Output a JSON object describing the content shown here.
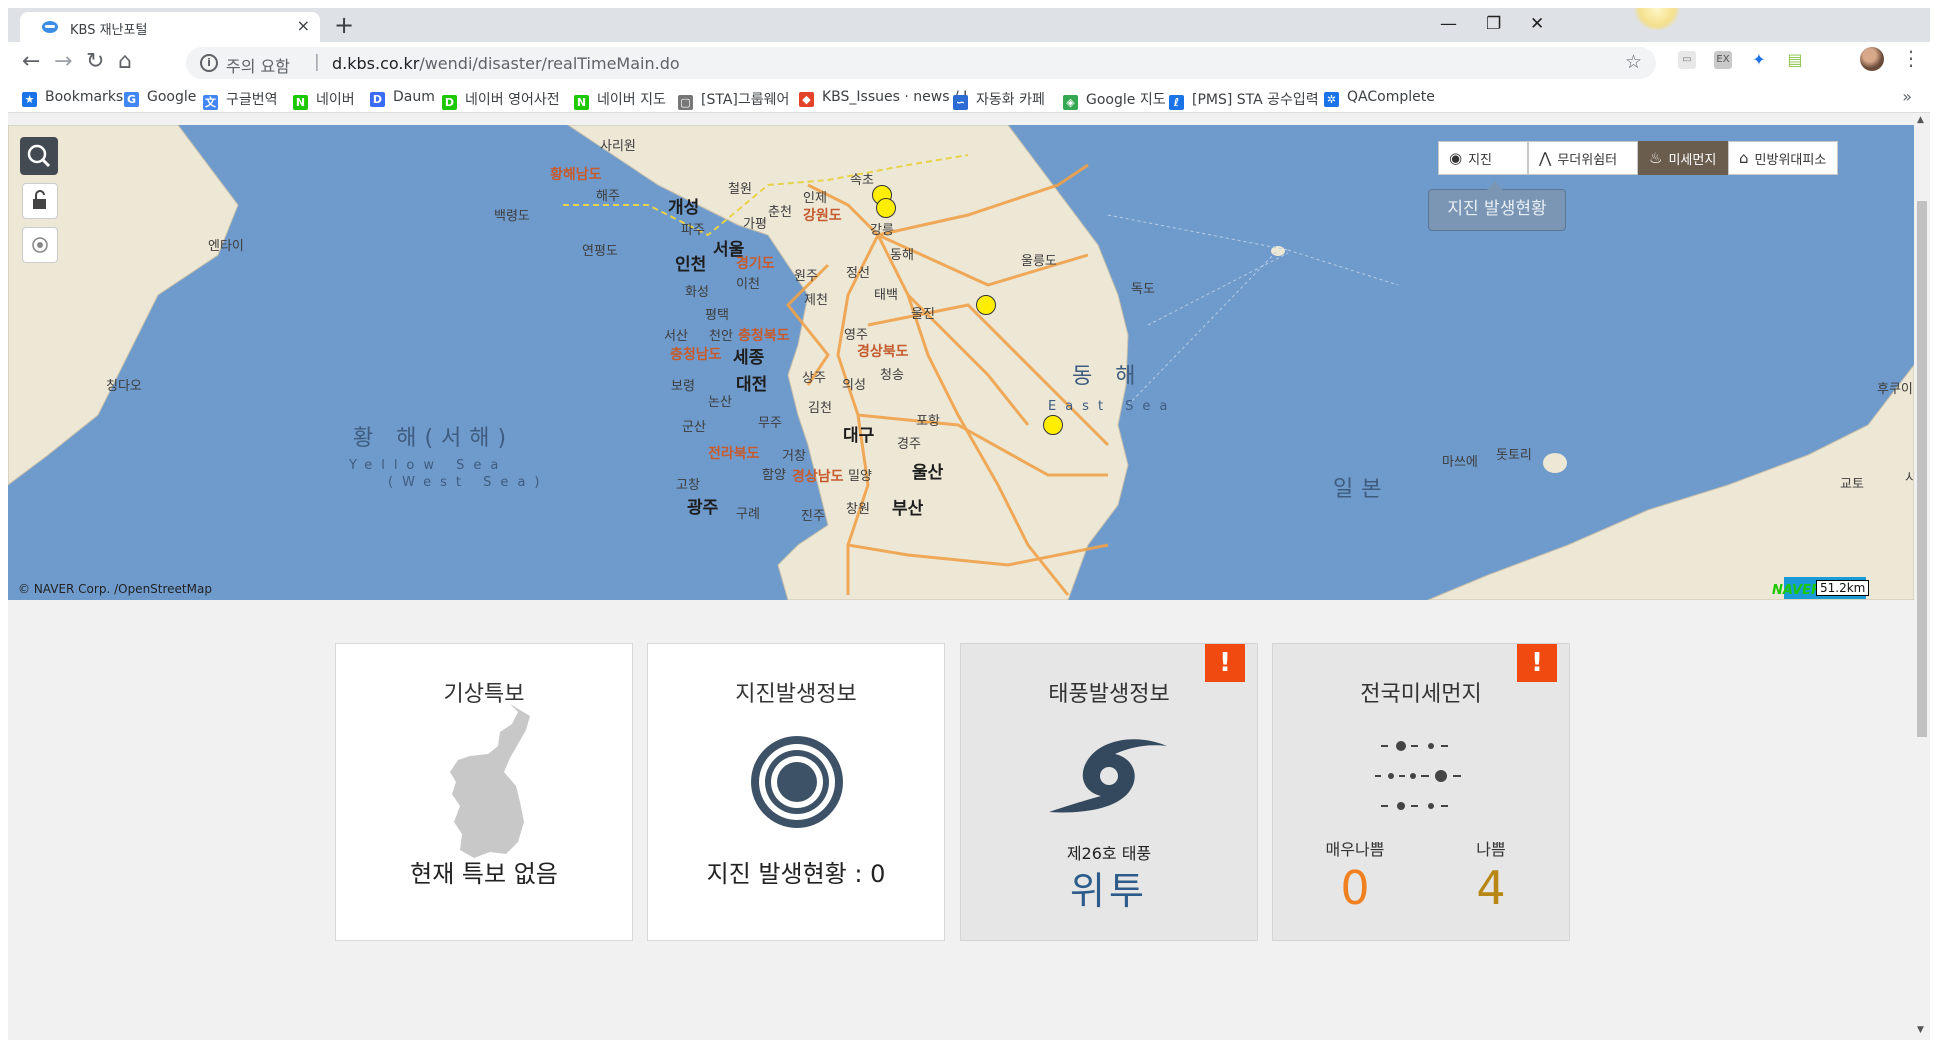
{
  "browser": {
    "tab_title": "KBS 재난포털",
    "tab_close": "×",
    "new_tab": "+",
    "window_controls": {
      "minimize": "—",
      "maximize": "❐",
      "close": "✕"
    },
    "nav": {
      "back": "←",
      "forward": "→",
      "reload": "↻",
      "home": "⌂"
    },
    "omnibox": {
      "security_text": "주의 요함",
      "separator": "|",
      "url_host": "d.kbs.co.kr",
      "url_path": "/wendi/disaster/realTimeMain.do",
      "star": "☆"
    },
    "menu": "⋮"
  },
  "bookmarks": {
    "items": [
      {
        "label": "Bookmarks",
        "icon": "star-icon",
        "color": "#1a73e8"
      },
      {
        "label": "Google",
        "icon": "google-icon",
        "color": "#4285f4"
      },
      {
        "label": "구글번역",
        "icon": "translate-icon",
        "color": "#4285f4"
      },
      {
        "label": "네이버",
        "icon": "naver-icon",
        "color": "#1ec800"
      },
      {
        "label": "Daum",
        "icon": "daum-icon",
        "color": "#3a6cf4"
      },
      {
        "label": "네이버 영어사전",
        "icon": "dictionary-icon",
        "color": "#1ec800"
      },
      {
        "label": "네이버 지도",
        "icon": "naver-icon",
        "color": "#1ec800"
      },
      {
        "label": "[STA]그룹웨어",
        "icon": "page-icon",
        "color": "#777777"
      },
      {
        "label": "KBS_Issues · news / I",
        "icon": "gitlab-icon",
        "color": "#e24329"
      },
      {
        "label": "자동화 카페",
        "icon": "cafe-icon",
        "color": "#2d6bd4"
      },
      {
        "label": "Google 지도",
        "icon": "maps-icon",
        "color": "#34a853"
      },
      {
        "label": "[PMS] STA 공수입력",
        "icon": "pms-icon",
        "color": "#1a73e8"
      },
      {
        "label": "QAComplete",
        "icon": "qa-icon",
        "color": "#1a73e8"
      }
    ],
    "more": "»"
  },
  "map": {
    "labels": [
      {
        "text": "황해남도",
        "cls": "prov"
      },
      {
        "text": "사리원",
        "cls": ""
      },
      {
        "text": "해주",
        "cls": ""
      },
      {
        "text": "개성",
        "cls": "city"
      },
      {
        "text": "백령도",
        "cls": ""
      },
      {
        "text": "연평도",
        "cls": ""
      },
      {
        "text": "서울",
        "cls": "city"
      },
      {
        "text": "인천",
        "cls": "city"
      },
      {
        "text": "파주",
        "cls": ""
      },
      {
        "text": "철원",
        "cls": ""
      },
      {
        "text": "춘천",
        "cls": ""
      },
      {
        "text": "가평",
        "cls": ""
      },
      {
        "text": "인제",
        "cls": ""
      },
      {
        "text": "속초",
        "cls": ""
      },
      {
        "text": "강원도",
        "cls": "prov"
      },
      {
        "text": "강릉",
        "cls": ""
      },
      {
        "text": "동해",
        "cls": ""
      },
      {
        "text": "경기도",
        "cls": "prov"
      },
      {
        "text": "이천",
        "cls": ""
      },
      {
        "text": "원주",
        "cls": ""
      },
      {
        "text": "정선",
        "cls": ""
      },
      {
        "text": "태백",
        "cls": ""
      },
      {
        "text": "제천",
        "cls": ""
      },
      {
        "text": "화성",
        "cls": ""
      },
      {
        "text": "평택",
        "cls": ""
      },
      {
        "text": "울진",
        "cls": ""
      },
      {
        "text": "서산",
        "cls": ""
      },
      {
        "text": "천안",
        "cls": ""
      },
      {
        "text": "충청북도",
        "cls": "prov"
      },
      {
        "text": "충청남도",
        "cls": "prov"
      },
      {
        "text": "세종",
        "cls": "city"
      },
      {
        "text": "영주",
        "cls": ""
      },
      {
        "text": "경상북도",
        "cls": "prov"
      },
      {
        "text": "청송",
        "cls": ""
      },
      {
        "text": "보령",
        "cls": ""
      },
      {
        "text": "대전",
        "cls": "city"
      },
      {
        "text": "상주",
        "cls": ""
      },
      {
        "text": "의성",
        "cls": ""
      },
      {
        "text": "논산",
        "cls": ""
      },
      {
        "text": "김천",
        "cls": ""
      },
      {
        "text": "포항",
        "cls": ""
      },
      {
        "text": "군산",
        "cls": ""
      },
      {
        "text": "무주",
        "cls": ""
      },
      {
        "text": "대구",
        "cls": "city"
      },
      {
        "text": "경주",
        "cls": ""
      },
      {
        "text": "전라북도",
        "cls": "prov"
      },
      {
        "text": "거창",
        "cls": ""
      },
      {
        "text": "울산",
        "cls": "city"
      },
      {
        "text": "함양",
        "cls": ""
      },
      {
        "text": "경상남도",
        "cls": "prov"
      },
      {
        "text": "밀양",
        "cls": ""
      },
      {
        "text": "고창",
        "cls": ""
      },
      {
        "text": "광주",
        "cls": "city"
      },
      {
        "text": "구례",
        "cls": ""
      },
      {
        "text": "진주",
        "cls": ""
      },
      {
        "text": "창원",
        "cls": ""
      },
      {
        "text": "부산",
        "cls": "city"
      },
      {
        "text": "울릉도",
        "cls": ""
      },
      {
        "text": "독도",
        "cls": ""
      },
      {
        "text": "엔타이",
        "cls": ""
      },
      {
        "text": "칭다오",
        "cls": ""
      },
      {
        "text": "황 해(서해)",
        "cls": "sea"
      },
      {
        "text": "Yellow Sea",
        "cls": "sea-en"
      },
      {
        "text": "(West Sea)",
        "cls": "sea-en"
      },
      {
        "text": "동 해",
        "cls": "sea"
      },
      {
        "text": "East Sea",
        "cls": "sea-en"
      },
      {
        "text": "일본",
        "cls": "sea"
      },
      {
        "text": "마쓰에",
        "cls": ""
      },
      {
        "text": "돗토리",
        "cls": ""
      },
      {
        "text": "후쿠이",
        "cls": ""
      },
      {
        "text": "교토",
        "cls": ""
      },
      {
        "text": "시마네",
        "cls": ""
      }
    ],
    "copyright": "© NAVER Corp. /OpenStreetMap",
    "logo": "NAVER",
    "scale": "51.2km",
    "layer_buttons": [
      {
        "label": "지진",
        "icon": "earthquake-icon",
        "glyph": "◉",
        "active": false
      },
      {
        "label": "무더위쉼터",
        "icon": "shelter-icon",
        "glyph": "⋀",
        "active": false
      },
      {
        "label": "미세먼지",
        "icon": "fine-dust-icon",
        "glyph": "♨",
        "active": true
      },
      {
        "label": "민방위대피소",
        "icon": "civil-defense-icon",
        "glyph": "⌂",
        "active": false
      }
    ],
    "tooltip": "지진 발생현황"
  },
  "cards": {
    "weather": {
      "title": "기상특보",
      "status": "현재 특보 없음"
    },
    "earthquake": {
      "title": "지진발생정보",
      "status": "지진 발생현황 : 0"
    },
    "typhoon": {
      "title": "태풍발생정보",
      "alert": "!",
      "sub": "제26호 태풍",
      "name": "위투"
    },
    "dust": {
      "title": "전국미세먼지",
      "alert": "!",
      "very_bad_label": "매우나쁨",
      "very_bad_value": "0",
      "bad_label": "나쁨",
      "bad_value": "4"
    }
  },
  "colors": {
    "sea": "#6f9bcc",
    "land": "#ede7d5",
    "road": "#f0a24a",
    "alert": "#f04a10",
    "typhoon_icon": "#34495e",
    "very_bad": "#f08020",
    "bad": "#b88614"
  }
}
